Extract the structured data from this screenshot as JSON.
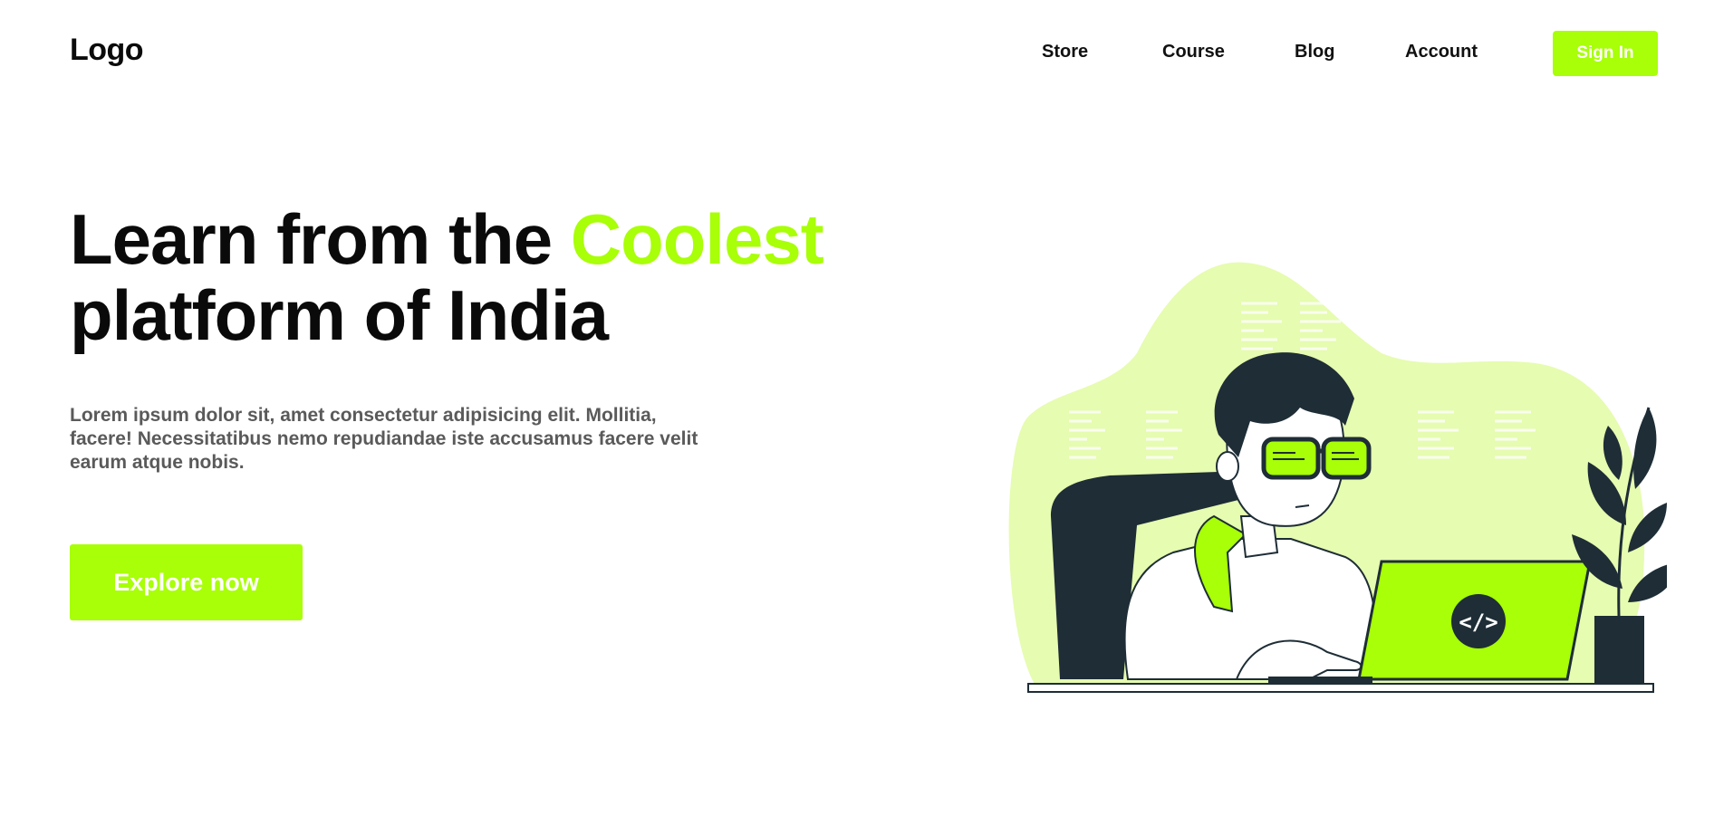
{
  "nav": {
    "logo": "Logo",
    "items": [
      {
        "label": "Store"
      },
      {
        "label": "Course"
      },
      {
        "label": "Blog"
      },
      {
        "label": "Account"
      }
    ],
    "signin_label": "Sign In"
  },
  "hero": {
    "title_part1": "Learn from the ",
    "title_accent": "Coolest",
    "title_part2": "platform of India",
    "description": "Lorem ipsum dolor sit, amet consectetur adipisicing elit. Mollitia, facere! Necessitatibus nemo repudiandae iste accusamus facere velit earum atque nobis.",
    "cta_label": "Explore now"
  },
  "illustration": {
    "code_badge": "</>",
    "icons": [
      "developer-illustration",
      "laptop-icon",
      "plant-icon",
      "code-badge-icon"
    ]
  },
  "colors": {
    "accent": "#a8ff07",
    "accent_light": "#e6fcb0",
    "dark": "#1e2d36",
    "text_muted": "#5a5a5a"
  }
}
